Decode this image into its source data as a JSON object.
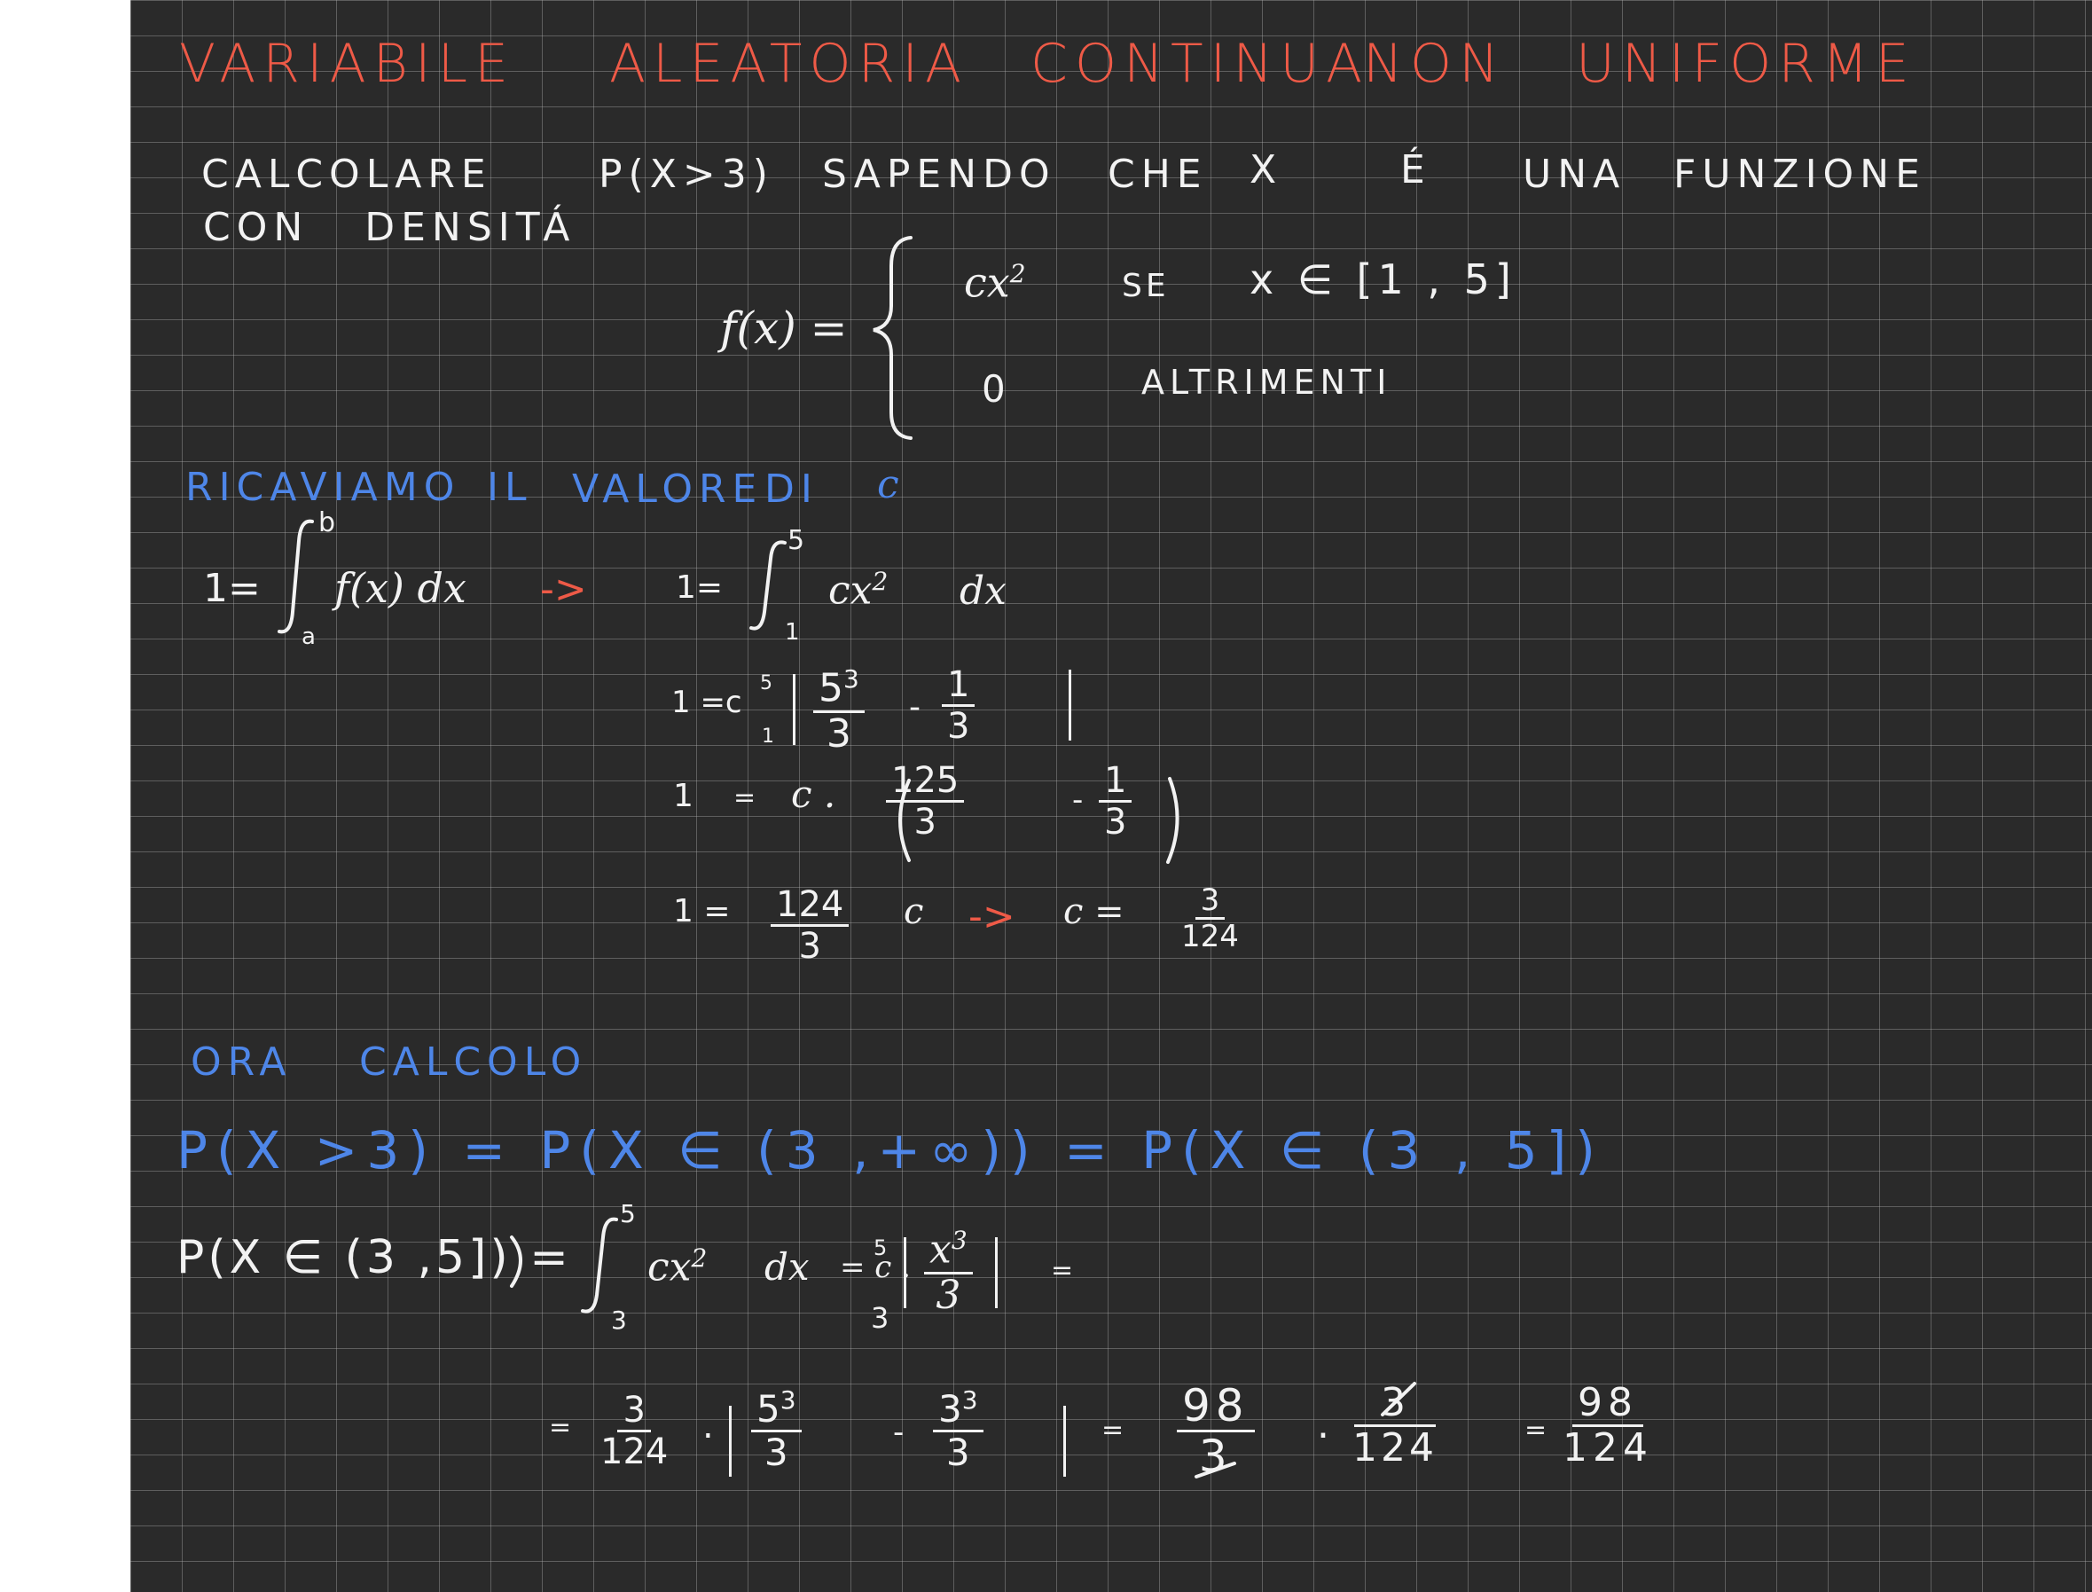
{
  "title": {
    "w1": "VARIABILE",
    "w2": "ALEATORIA",
    "w3": "CONTINUA",
    "w4": "NON",
    "w5": "UNIFORME"
  },
  "problem": {
    "line1": {
      "calcolare": "CALCOLARE",
      "prob": "P(X>3)",
      "sapendo": "SAPENDO",
      "che": "CHE",
      "x": "X",
      "e": "É",
      "una": "UNA",
      "funzione": "FUNZIONE"
    },
    "line2": "CON   DENSITÁ"
  },
  "density": {
    "lhs": "f(x) =",
    "case1_expr": "cx",
    "case1_exp": "2",
    "case1_cond": "SE",
    "case1_range": "x ∈ [1 , 5]",
    "case2_expr": "0",
    "case2_cond": "ALTRIMENTI"
  },
  "step1_heading": {
    "w1": "RICAVIAMO",
    "w2": "IL",
    "w3": "VALORE",
    "w4": "DI",
    "w5": "c"
  },
  "step1": {
    "eq_lhs": "1=",
    "int_upper": "b",
    "int_lower": "a",
    "integrand": "f(x) dx",
    "arrow": "->",
    "eq2_lhs": "1=",
    "int2_upper": "5",
    "int2_lower": "1",
    "int2_body": "cx",
    "int2_exp": "2",
    "int2_dx": "dx",
    "row2_lhs": "1 =c",
    "row2_eval_up": "5",
    "row2_eval_low": "1",
    "row2_num1": "5",
    "row2_num1_exp": "3",
    "row2_den1": "3",
    "row2_minus": "-",
    "row2_num2": "1",
    "row2_den2": "3",
    "row3_lhs": "1",
    "row3_eq": "=",
    "row3_c": "c .",
    "row3_num1": "125",
    "row3_den1": "3",
    "row3_minus": "-",
    "row3_num2": "1",
    "row3_den2": "3",
    "row4_lhs": "1 =",
    "row4_num": "124",
    "row4_den": "3",
    "row4_c": "c",
    "row4_arrow": "->",
    "row4_res": "c =",
    "row4_res_num": "3",
    "row4_res_den": "124"
  },
  "step2_heading": {
    "w1": "ORA",
    "w2": "CALCOLO"
  },
  "step2": {
    "blue_line": "P(X >3) = P(X ∈ (3 ,+∞)) = P(X ∈ (3 , 5])",
    "lhs": "P(X ∈ (3 ,5]) =",
    "int_upper": "5",
    "int_lower": "3",
    "int_body": "cx",
    "int_exp": "2",
    "int_dx": "dx",
    "eq": "= c .",
    "eval_up": "5",
    "eval_low": "3",
    "frac_num": "x",
    "frac_num_exp": "3",
    "frac_den": "3",
    "tail_eq": "=",
    "r2_eq": "=",
    "r2_num": "3",
    "r2_den": "124",
    "r2_dot": ".",
    "r2_n1": "5",
    "r2_n1_exp": "3",
    "r2_d1": "3",
    "r2_minus": "-",
    "r2_n2": "3",
    "r2_n2_exp": "3",
    "r2_d2": "3",
    "r2_eq2": "=",
    "r2_res_num": "98",
    "r2_res_den": "3",
    "r2_dot2": ".",
    "r2_f_num": "3",
    "r2_f_den": "124",
    "r2_eq3": "=",
    "r2_final_num": "98",
    "r2_final_den": "124"
  },
  "colors": {
    "paper": "#2a2a2a",
    "grid": "#8c8c8c",
    "white_ink": "#f2f2f2",
    "red_ink": "#ee5a47",
    "blue_ink": "#4e86e8"
  }
}
